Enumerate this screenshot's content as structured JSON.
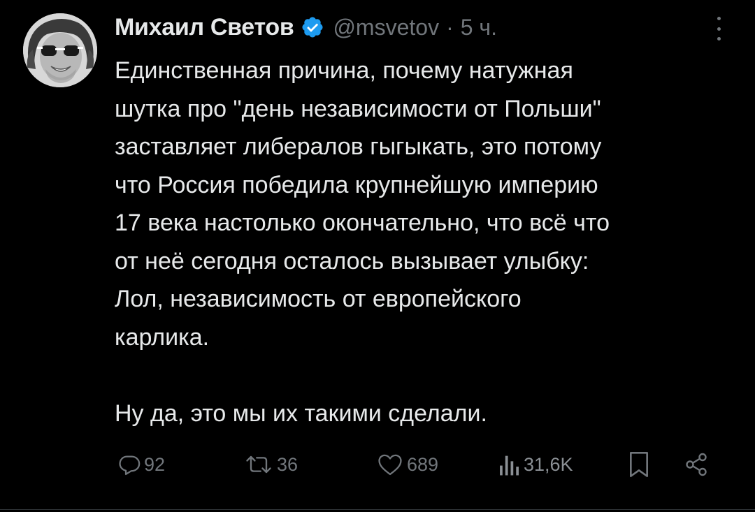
{
  "tweet": {
    "author_name": "Михаил Светов",
    "handle": "@msvetov",
    "separator": "·",
    "time": "5 ч.",
    "text": "Единственная причина, почему натужная\nшутка про \"день независимости от Польши\"\nзаставляет либералов гыгыкать, это потому\nчто Россия победила крупнейшую империю\n17 века настолько окончательно, что всё что\nот неё сегодня осталось вызывает улыбку:\nЛол, независимость от европейского\nкарлика.\n\nНу да, это мы их такими сделали.",
    "verified": true
  },
  "actions": {
    "replies": "92",
    "retweets": "36",
    "likes": "689",
    "views": "31,6K"
  },
  "icons": {
    "verified": "verified-badge-icon",
    "more": "more-vertical-icon",
    "reply": "reply-icon",
    "retweet": "retweet-icon",
    "like": "heart-icon",
    "views": "views-icon",
    "bookmark": "bookmark-icon",
    "share": "share-icon"
  },
  "colors": {
    "background": "#000000",
    "text_primary": "#e7e9ea",
    "text_secondary": "#71767b",
    "verified_blue": "#1d9bf0"
  }
}
